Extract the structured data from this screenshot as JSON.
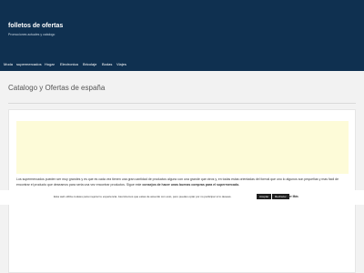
{
  "header": {
    "site_title": "folletos de ofertas",
    "tagline": "Promociones actuales y catalogo"
  },
  "nav": {
    "items": [
      "Moda",
      "supermercados",
      "Hogar",
      "Electronica",
      "Bricolaje",
      "Bodas",
      "Viajes"
    ]
  },
  "page": {
    "title": "Catalogo y Ofertas de españa"
  },
  "content": {
    "paragraph_part1": "Los supermercados pueden ser muy grandes y es que es cada vez tienen una gran cantidad de productos alguno con una grande que otros y, en todas estas orientadas del formal que uno lo algunos son pequeñas y mas fácil de encontrar el producto que deseamos para seria una vez encontrar productos. Sigue este",
    "paragraph_bold": "consejos de hacer unas buenas compras para el supermercado."
  },
  "cookie_bar": {
    "text": "Esta web utiliza cookies para mejorar tu experiencia. Asumiremos que estas de acuerdo con esto, pero puedes optar por no participar si lo deseas.",
    "accept_label": "Aceptar",
    "reject_label": "Rechazar",
    "read_more_label": "Leer Más"
  },
  "colors": {
    "header_bg": "#0f3050",
    "page_bg": "#f2f2f2",
    "ad_bg": "#fdfbd8"
  }
}
